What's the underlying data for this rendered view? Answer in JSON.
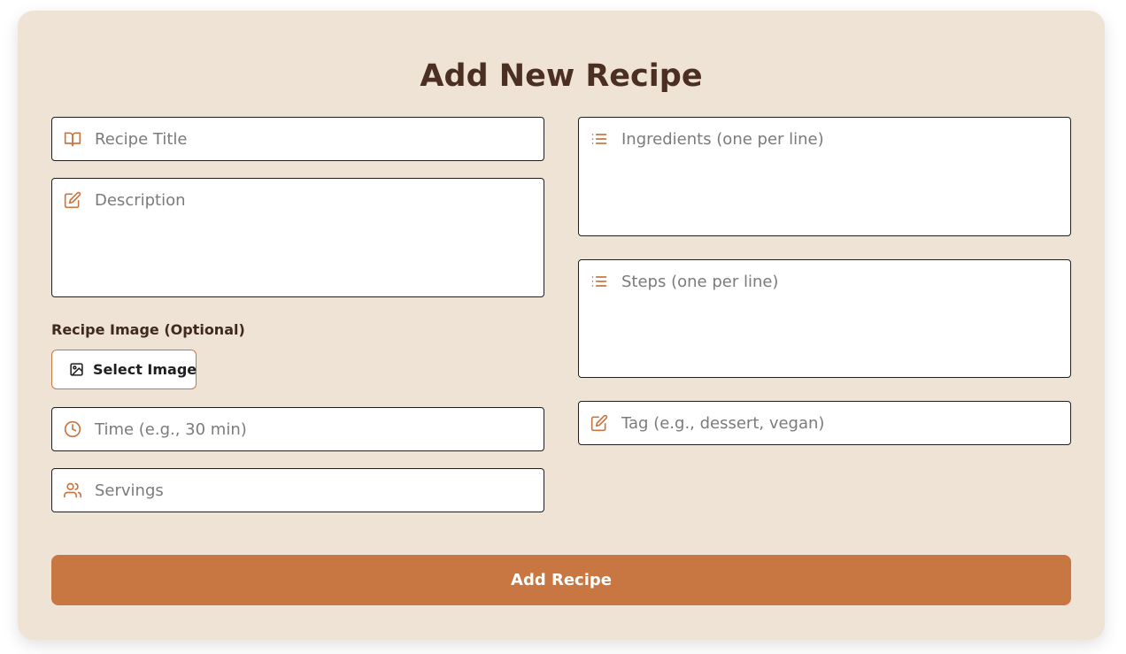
{
  "form": {
    "title": "Add New Recipe",
    "title_placeholder": "Recipe Title",
    "description_placeholder": "Description",
    "ingredients_placeholder": "Ingredients (one per line)",
    "steps_placeholder": "Steps (one per line)",
    "tag_placeholder": "Tag (e.g., dessert, vegan)",
    "image_label": "Recipe Image (Optional)",
    "select_image_label": "Select Image",
    "time_placeholder": "Time (e.g., 30 min)",
    "servings_placeholder": "Servings",
    "submit_label": "Add Recipe"
  },
  "icons": {
    "title": "book-open-icon",
    "description": "edit-icon",
    "ingredients": "list-icon",
    "steps": "list-icon",
    "tag": "edit-icon",
    "image": "image-icon",
    "time": "clock-icon",
    "servings": "users-icon"
  },
  "colors": {
    "background": "#eee3d4",
    "accent": "#c87742",
    "title": "#4a2f22",
    "placeholder": "#7b7b7b"
  }
}
